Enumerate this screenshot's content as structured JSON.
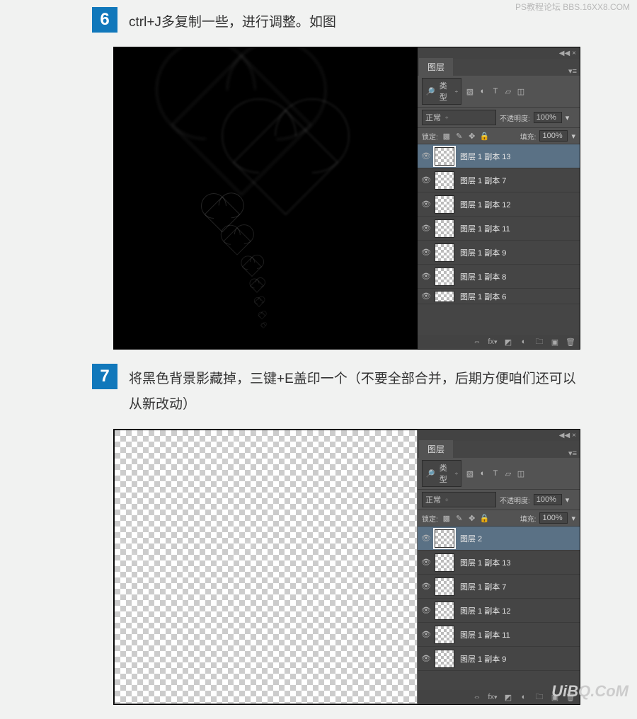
{
  "watermark_top": "PS教程论坛\nBBS.16XX8.COM",
  "watermark_bottom": "UiBQ.CoM",
  "steps": [
    {
      "num": "6",
      "text": "ctrl+J多复制一些，进行调整。如图"
    },
    {
      "num": "7",
      "text": "将黑色背景影藏掉，三键+E盖印一个（不要全部合并，后期方便咱们还可以从新改动）"
    }
  ],
  "panel": {
    "tab": "图层",
    "type_label": "类型",
    "blend_mode": "正常",
    "opacity_label": "不透明度:",
    "opacity_value": "100%",
    "lock_label": "锁定:",
    "fill_label": "填充:",
    "fill_value": "100%"
  },
  "layers_shot1": [
    "图层 1 副本 13",
    "图层 1 副本 7",
    "图层 1 副本 12",
    "图层 1 副本 11",
    "图层 1 副本 9",
    "图层 1 副本 8",
    "图层 1 副本 6"
  ],
  "layers_shot2": [
    "图层 2",
    "图层 1 副本 13",
    "图层 1 副本 7",
    "图层 1 副本 12",
    "图层 1 副本 11",
    "图层 1 副本 9"
  ]
}
